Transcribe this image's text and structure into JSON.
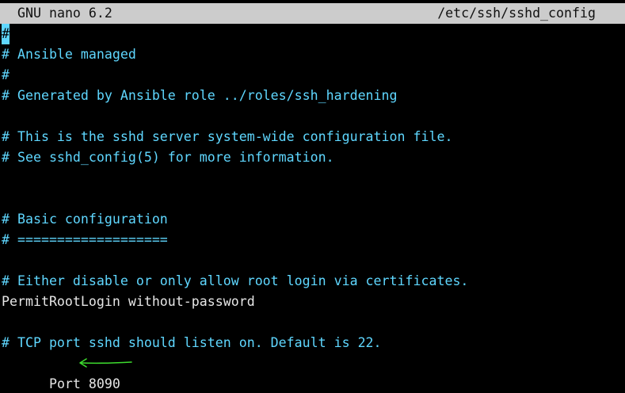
{
  "titlebar": {
    "app_name": "GNU nano 6.2",
    "file_path": "/etc/ssh/sshd_config"
  },
  "editor": {
    "cursor_char": "#",
    "lines": [
      {
        "text": "",
        "kind": "cursor"
      },
      {
        "text": "# Ansible managed",
        "kind": "comment"
      },
      {
        "text": "#",
        "kind": "comment"
      },
      {
        "text": "# Generated by Ansible role ../roles/ssh_hardening",
        "kind": "comment"
      },
      {
        "text": "",
        "kind": "blank"
      },
      {
        "text": "# This is the sshd server system-wide configuration file.",
        "kind": "comment"
      },
      {
        "text": "# See sshd_config(5) for more information.",
        "kind": "comment"
      },
      {
        "text": "",
        "kind": "blank"
      },
      {
        "text": "",
        "kind": "blank"
      },
      {
        "text": "# Basic configuration",
        "kind": "comment"
      },
      {
        "text": "# ===================",
        "kind": "comment"
      },
      {
        "text": "",
        "kind": "blank"
      },
      {
        "text": "# Either disable or only allow root login via certificates.",
        "kind": "comment"
      },
      {
        "text": "PermitRootLogin without-password",
        "kind": "plain"
      },
      {
        "text": "",
        "kind": "blank"
      },
      {
        "text": "# TCP port sshd should listen on. Default is 22.",
        "kind": "comment"
      },
      {
        "text": "Port 8090",
        "kind": "plain"
      }
    ]
  },
  "colors": {
    "background": "#000000",
    "titlebar_bg": "#cccccc",
    "comment": "#5fd7ff",
    "plain_text": "#e6e6e6",
    "annotation_arrow": "#3ddc2e"
  },
  "annotation": {
    "icon": "arrow-left-icon"
  }
}
